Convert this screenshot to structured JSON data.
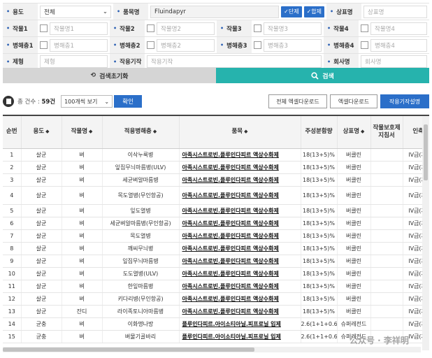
{
  "form": {
    "row1": {
      "use_label": "용도",
      "use_value": "전체",
      "product_label": "품목명",
      "product_value": "Fluindapyr",
      "single_btn": "단제",
      "mix_btn": "합제",
      "brand_label": "상표명",
      "brand_placeholder": "상표명"
    },
    "row2": {
      "crop1_label": "작물1",
      "crop1_placeholder": "작물명1",
      "crop2_label": "작물2",
      "crop2_placeholder": "작물명2",
      "crop3_label": "작물3",
      "crop3_placeholder": "작물명3",
      "crop4_label": "작물4",
      "crop4_placeholder": "작물명4"
    },
    "row3": {
      "pest1_label": "병해충1",
      "pest1_placeholder": "병해충1",
      "pest2_label": "병해충2",
      "pest2_placeholder": "병해충2",
      "pest3_label": "병해충3",
      "pest3_placeholder": "병해충3",
      "pest4_label": "병해충4",
      "pest4_placeholder": "병해충4"
    },
    "row4": {
      "form_label": "제형",
      "form_placeholder": "제형",
      "mechanism_label": "작용기작",
      "mechanism_placeholder": "작용기작",
      "company_label": "회사명",
      "company_placeholder": "회사명"
    }
  },
  "buttons": {
    "reset": "검색초기화",
    "search": "검색"
  },
  "toolbar": {
    "count_prefix": "총 건수 :",
    "count_value": "59건",
    "page_size": "100개씩 보기",
    "confirm": "확인",
    "excel_all": "전체 엑셀다운로드",
    "excel": "엑셀다운로드",
    "mechanism": "작용기작설명"
  },
  "table": {
    "headers": [
      "순번",
      "용도",
      "작물명",
      "적용병해충",
      "품목",
      "주성분함량",
      "상표명",
      "작물보호제 지침서",
      "인축독성"
    ],
    "rows": [
      [
        "1",
        "살균",
        "벼",
        "이삭누룩병",
        "아족시스트로빈.플루인다피르 액상수화제",
        "18(13+5)%",
        "버클린",
        "",
        "IV급(저독성)"
      ],
      [
        "2",
        "살균",
        "벼",
        "잎집무늬마름병(ULV)",
        "아족시스트로빈.플루인다피르 액상수화제",
        "18(13+5)%",
        "버클린",
        "",
        "IV급(저독성)"
      ],
      [
        "3",
        "살균",
        "벼",
        "세균벼알마름병",
        "아족시스트로빈.플루인다피르 액상수화제",
        "18(13+5)%",
        "버클린",
        "",
        "IV급(저독성)"
      ],
      [
        "4",
        "살균",
        "벼",
        "목도열병(무인항공)",
        "아족시스트로빈.플루인다피르 액상수화제",
        "18(13+5)%",
        "버클린",
        "",
        "IV급(저독성)"
      ],
      [
        "5",
        "살균",
        "벼",
        "잎도열병",
        "아족시스트로빈.플루인다피르 액상수화제",
        "18(13+5)%",
        "버클린",
        "",
        "IV급(저독성)"
      ],
      [
        "6",
        "살균",
        "벼",
        "세균벼알마름병(무인항공)",
        "아족시스트로빈.플루인다피르 액상수화제",
        "18(13+5)%",
        "버클린",
        "",
        "IV급(저독성)"
      ],
      [
        "7",
        "살균",
        "벼",
        "목도열병",
        "아족시스트로빈.플루인다피르 액상수화제",
        "18(13+5)%",
        "버클린",
        "",
        "IV급(저독성)"
      ],
      [
        "8",
        "살균",
        "벼",
        "깨씨무늬병",
        "아족시스트로빈.플루인다피르 액상수화제",
        "18(13+5)%",
        "버클린",
        "",
        "IV급(저독성)"
      ],
      [
        "9",
        "살균",
        "벼",
        "잎집무늬마름병",
        "아족시스트로빈.플루인다피르 액상수화제",
        "18(13+5)%",
        "버클린",
        "",
        "IV급(저독성)"
      ],
      [
        "10",
        "살균",
        "벼",
        "도도열병(ULV)",
        "아족시스트로빈.플루인다피르 액상수화제",
        "18(13+5)%",
        "버클린",
        "",
        "IV급(저독성)"
      ],
      [
        "11",
        "살균",
        "벼",
        "한잎마름병",
        "아족시스트로빈.플루인다피르 액상수화제",
        "18(13+5)%",
        "버클린",
        "",
        "IV급(저독성)"
      ],
      [
        "12",
        "살균",
        "벼",
        "키다리병(무인항공)",
        "아족시스트로빈.플루인다피르 액상수화제",
        "18(13+5)%",
        "버클린",
        "",
        "IV급(저독성)"
      ],
      [
        "13",
        "살균",
        "잔디",
        "라이족토니아마름병",
        "아족시스트로빈.플루인다피르 액상수화제",
        "18(13+5)%",
        "버클린",
        "",
        "IV급(저독성)"
      ],
      [
        "14",
        "균충",
        "벼",
        "이화명나방",
        "플루인다피르.아이소티아닐.피프로닐 입제",
        "2.6(1+1+0.6)%",
        "슈퍼레전드",
        "",
        "IV급(저독성)"
      ],
      [
        "15",
        "균충",
        "벼",
        "벼물기골바리",
        "플루인다피르.아이소티아닐.피프로닐 입제",
        "2.6(1+1+0.6)%",
        "슈퍼레전드",
        "",
        "IV급(저독성)"
      ]
    ]
  },
  "watermark": "公众号 · 李祥明"
}
